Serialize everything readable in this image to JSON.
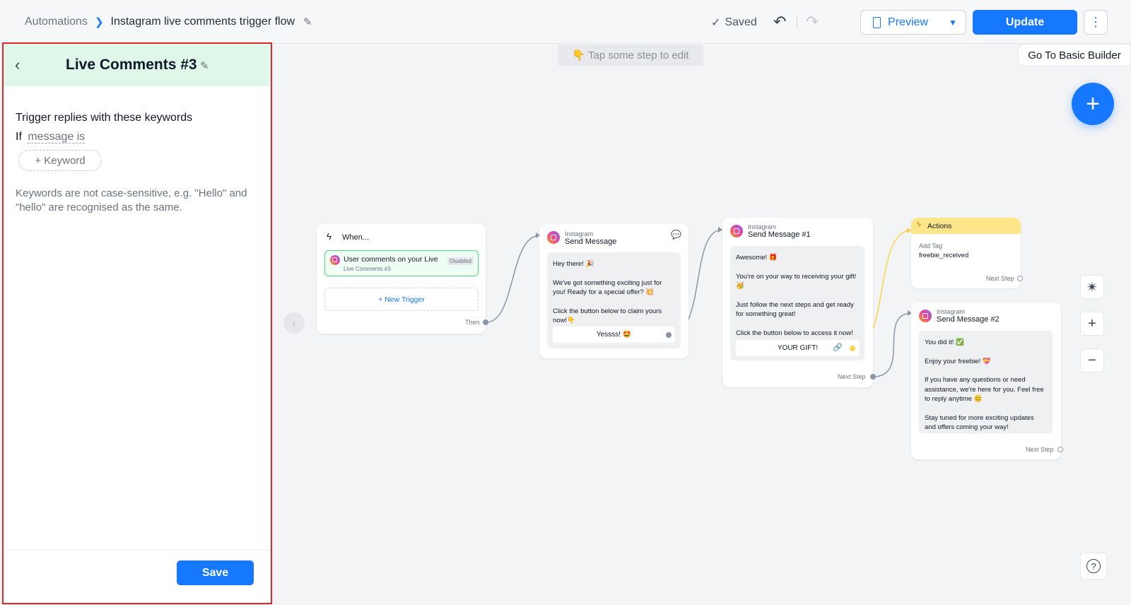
{
  "breadcrumb": {
    "root": "Automations",
    "current": "Instagram live comments trigger flow"
  },
  "toolbar": {
    "saved": "Saved",
    "preview": "Preview",
    "update": "Update"
  },
  "panel": {
    "title": "Live Comments #3",
    "trigger_label": "Trigger replies with these keywords",
    "if_word": "If",
    "condition": "message is",
    "keyword_button": "+ Keyword",
    "help": "Keywords are not case-sensitive, e.g. \"Hello\" and \"hello\" are recognised as the same.",
    "save": "Save"
  },
  "canvas": {
    "hint": "👇 Tap some step to edit",
    "basic_builder": "Go To Basic Builder"
  },
  "trigger_card": {
    "title": "When...",
    "item_title": "User comments on your Live",
    "item_sub": "Live Comments #3",
    "item_badge": "Disabled",
    "new_trigger": "+ New Trigger",
    "then": "Then"
  },
  "msg1": {
    "platform": "Instagram",
    "title": "Send Message",
    "lines": [
      "Hey there! 🎉",
      "",
      "We've got something exciting just for you! Ready for a special offer? 💥",
      "",
      "Click the button below to claim yours now!👇"
    ],
    "button": "Yessss! 🤩"
  },
  "msg2": {
    "platform": "Instagram",
    "title": "Send Message #1",
    "lines": [
      "Awesome! 🎁",
      "",
      "You're on your way to receiving your gift! 🥳",
      "",
      "Just follow the next steps and get ready for something great!",
      "",
      "Click the button below to access it now!"
    ],
    "button": "YOUR GIFT!",
    "next": "Next Step"
  },
  "actions": {
    "title": "Actions",
    "label": "Add Tag",
    "value": "freebie_received",
    "next": "Next Step"
  },
  "msg3": {
    "platform": "Instagram",
    "title": "Send Message #2",
    "lines": [
      "You did it! ✅",
      "",
      "Enjoy your freebie! 💝",
      "",
      "If you have any questions or need assistance, we're here for you. Feel free to reply anytime 😊",
      "",
      "Stay tuned for more exciting updates and offers coming your way!"
    ],
    "next": "Next Step"
  },
  "colors": {
    "accent": "#1677ff",
    "panel_border": "#e0262a",
    "panel_header": "#dff7e8",
    "actions_header": "#fde68a"
  }
}
